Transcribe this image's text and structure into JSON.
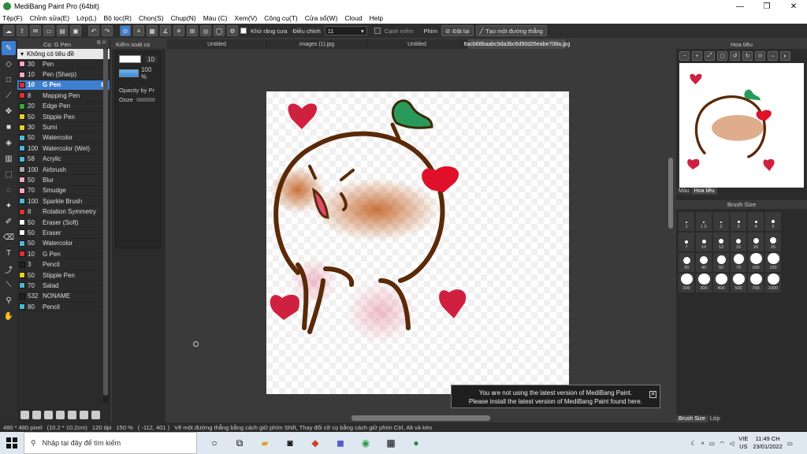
{
  "window": {
    "title": "MediBang Paint Pro (64bit)",
    "minimize": "—",
    "maximize": "❐",
    "close": "✕"
  },
  "menu": [
    "Tệp(F)",
    "Chỉnh sửa(E)",
    "Lớp(L)",
    "Bộ lọc(R)",
    "Chọn(S)",
    "Chụp(N)",
    "Màu (C)",
    "Xem(V)",
    "Công cụ(T)",
    "Cửa sổ(W)",
    "Cloud",
    "Help"
  ],
  "toolbar": {
    "antialias_label": "Khử răng cưa",
    "adjust_label": "Điều chỉnh",
    "adjust_value": "11",
    "edge_label": "Cạnh mềm",
    "key_label": "Phím",
    "reset_label": "Đặt lại",
    "straight_label": "Tạo một đường thẳng"
  },
  "brush_panel": {
    "title": "Cọ: G Pen",
    "group": "Không có tiêu đề",
    "items": [
      {
        "size": "30",
        "name": "Pen",
        "color": "#f4a6c8"
      },
      {
        "size": "10",
        "name": "Pen (Sharp)",
        "color": "#f4a6c8"
      },
      {
        "size": "10",
        "name": "G Pen",
        "color": "#e03030",
        "selected": true
      },
      {
        "size": "8",
        "name": "Mapping Pen",
        "color": "#e03030"
      },
      {
        "size": "20",
        "name": "Edge Pen",
        "color": "#33aa33"
      },
      {
        "size": "50",
        "name": "Stipple Pen",
        "color": "#e8d020"
      },
      {
        "size": "30",
        "name": "Sumi",
        "color": "#e8d020"
      },
      {
        "size": "50",
        "name": "Watercolor",
        "color": "#4fb8d8"
      },
      {
        "size": "100",
        "name": "Watercolor (Wet)",
        "color": "#4fb8d8"
      },
      {
        "size": "58",
        "name": "Acrylic",
        "color": "#4fb8d8"
      },
      {
        "size": "100",
        "name": "Airbrush",
        "color": "#aaaaaa"
      },
      {
        "size": "50",
        "name": "Blur",
        "color": "#f4a6c8"
      },
      {
        "size": "70",
        "name": "Smudge",
        "color": "#f4a6c8"
      },
      {
        "size": "100",
        "name": "Sparkle Brush",
        "color": "#4fb8d8"
      },
      {
        "size": "8",
        "name": "Rotation Symmetry",
        "color": "#e03030"
      },
      {
        "size": "50",
        "name": "Eraser (Soft)",
        "color": "#ffffff"
      },
      {
        "size": "50",
        "name": "Eraser",
        "color": "#ffffff"
      },
      {
        "size": "50",
        "name": "Watercolor",
        "color": "#4fb8d8"
      },
      {
        "size": "10",
        "name": "G Pen",
        "color": "#e03030"
      },
      {
        "size": "3",
        "name": "Pencil",
        "color": "#222222"
      },
      {
        "size": "50",
        "name": "Stipple Pen",
        "color": "#e8d020"
      },
      {
        "size": "70",
        "name": "Salad",
        "color": "#4fb8d8"
      },
      {
        "size": "532",
        "name": "NONAME",
        "color": "#222222"
      },
      {
        "size": "80",
        "name": "Pencil",
        "color": "#4fb8d8"
      }
    ]
  },
  "control_panel": {
    "title": "Kiểm soát cọ",
    "size": "10",
    "opacity": "100 %",
    "opacity_by_pressure": "Opacity by Pr",
    "ooze": "Ooze"
  },
  "tabs": [
    "Untitled",
    "images (1).jpg",
    "Untitled",
    "6acb68baabc9da3bc6d90d26eabe708a.jpg"
  ],
  "navigator": {
    "title": "Hoa tiêu",
    "subtab_color": "Màu",
    "subtab_nav": "Hoa tiêu"
  },
  "brush_size": {
    "title": "Brush Size",
    "sizes": [
      "1",
      "1.5",
      "2",
      "3",
      "4",
      "5",
      "7",
      "10",
      "12",
      "15",
      "20",
      "25",
      "30",
      "40",
      "50",
      "70",
      "100",
      "150",
      "200",
      "300",
      "400",
      "500",
      "700",
      "1000"
    ],
    "foot_size": "Brush Size",
    "foot_layer": "Lớp"
  },
  "notice": {
    "line1": "You are not using the latest version of MediBang Paint.",
    "line2": "Please install the latest version of MediBang Paint found here."
  },
  "status": {
    "dims": "480 * 480 pixel",
    "cm": "(10.2 * 10.2cm)",
    "dpi": "120 dpi",
    "zoom": "150 %",
    "coords": "( -112, 401 )",
    "hint": "Vẽ một đường thẳng bằng cách giữ phím Shift, Thay đổi cỡ cọ bằng cách giữ phím Ctrl, Alt và kéo"
  },
  "taskbar": {
    "search": "Nhập tại đây để tìm kiếm",
    "lang1": "VIE",
    "lang2": "US",
    "time": "11:49 CH",
    "date": "23/01/2022"
  }
}
